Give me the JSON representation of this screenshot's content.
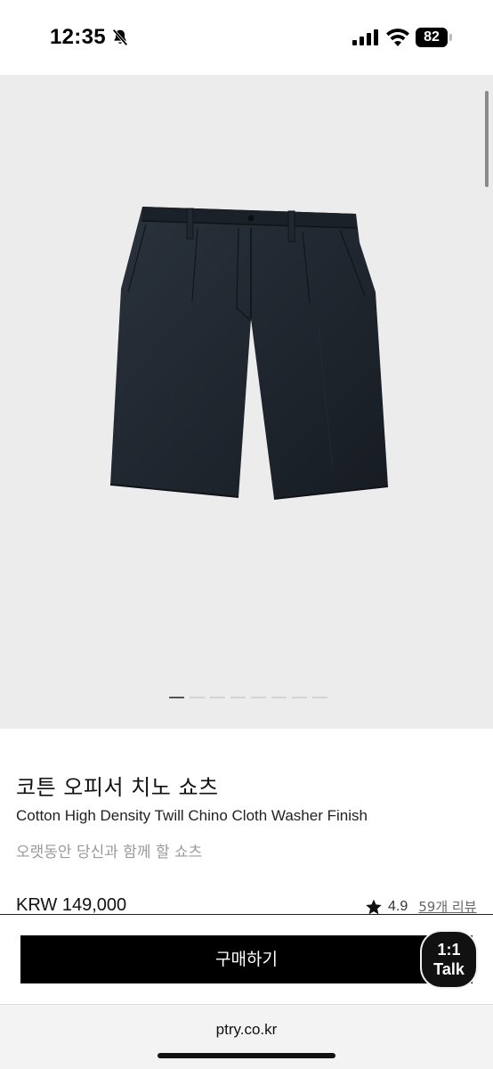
{
  "status_bar": {
    "time": "12:35",
    "battery": "82",
    "icons": [
      "bell-slash-icon",
      "cellular-signal-icon",
      "wifi-icon",
      "battery-icon"
    ]
  },
  "gallery": {
    "image": "navy-chino-shorts",
    "background_color": "#ececec",
    "page_count": 8,
    "active_index": 0
  },
  "product": {
    "title": "코튼 오피서 치노 쇼츠",
    "subtitle": "Cotton High Density Twill Chino Cloth Washer Finish",
    "tagline": "오랫동안 당신과 함께 할 쇼츠",
    "price": "KRW 149,000",
    "rating": "4.9",
    "reviews": "59개 리뷰"
  },
  "actions": {
    "buy_label": "구매하기",
    "talk_line1": "1:1",
    "talk_line2": "Talk"
  },
  "browser": {
    "url": "ptry.co.kr"
  }
}
